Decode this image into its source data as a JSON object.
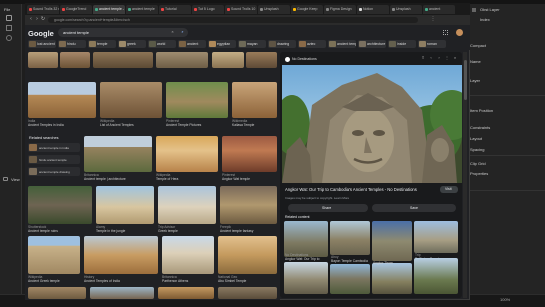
{
  "left_panel": {
    "file_label": "File",
    "view_label": "View",
    "doc_tab": "image"
  },
  "right_panel": {
    "tab1": "Obst Layer",
    "tab2": "Index",
    "labels": [
      "Compact",
      "Name",
      "Layer",
      "Item Position",
      "Constraints",
      "Layout",
      "Spacing",
      "Clip Grid",
      "Properties"
    ]
  },
  "browser": {
    "tabs": [
      {
        "label": "Sound Trolls 32 min",
        "color": "#e44"
      },
      {
        "label": "GoogleTrend",
        "color": "#e44"
      },
      {
        "label": "ancient temple - Google Images",
        "color": "#4a8"
      },
      {
        "label": "ancient temple",
        "color": "#4a8"
      },
      {
        "label": "Tutorial",
        "color": "#e44"
      },
      {
        "label": "Tut 5 Logo",
        "color": "#e44"
      },
      {
        "label": "Sound Trolls 10",
        "color": "#e44"
      },
      {
        "label": "Unsplash",
        "color": "#888"
      },
      {
        "label": "Google Keep",
        "color": "#fb0"
      },
      {
        "label": "Figma Design",
        "color": "#888"
      },
      {
        "label": "Notion",
        "color": "#ddd"
      },
      {
        "label": "Unsplash",
        "color": "#888"
      },
      {
        "label": "ancient",
        "color": "#4a8"
      }
    ],
    "address": "google.com/search?q=ancient+temple&tbm=isch"
  },
  "google": {
    "logo": "Google",
    "query": "ancient temple",
    "chips": [
      "lost ancient",
      "hindu",
      "temple",
      "greek",
      "world",
      "ancient",
      "egyptian",
      "mayan",
      "drawing",
      "aztec",
      "ancient temple",
      "architecture",
      "inside",
      "roman"
    ]
  },
  "results": {
    "related_title": "Related searches",
    "related": [
      "ancient temple in india",
      "hindu ancient temple",
      "ancient temple drawing"
    ],
    "captions": [
      {
        "src": "India",
        "title": "Ancient Temples in India"
      },
      {
        "src": "Wikipedia",
        "title": "List of Ancient Temples"
      },
      {
        "src": "Pinterest",
        "title": "Ancient Temple Pictures"
      },
      {
        "src": "Wikimedia",
        "title": "Kailasa Temple"
      },
      {
        "src": "Britannica",
        "title": "Ancient temple | architecture"
      },
      {
        "src": "Wikipedia",
        "title": "Temple of Hera"
      },
      {
        "src": "Pinterest",
        "title": "Angkor Wat temple"
      },
      {
        "src": "Shutterstock",
        "title": "Ancient temple ruins"
      },
      {
        "src": "Alamy",
        "title": "Temple in the jungle"
      },
      {
        "src": "Trip Advisor",
        "title": "Greek temple"
      },
      {
        "src": "Wikipedia",
        "title": "Ancient Greek temple"
      },
      {
        "src": "Freepik",
        "title": "Ancient temple fantasy"
      },
      {
        "src": "Britannica",
        "title": "Parthenon Athens"
      },
      {
        "src": "History",
        "title": "Ancient Temples of India"
      },
      {
        "src": "National Geo",
        "title": "Abu Simbel Temple"
      }
    ]
  },
  "preview": {
    "site": "No Destinations",
    "title": "Angkor Wat: Our Trip to Cambodia's Ancient Temples - No Destinations",
    "subtitle": "Images may be subject to copyright. Learn More",
    "visit_label": "Visit",
    "share_label": "Share",
    "save_label": "Save",
    "related_label": "Related content",
    "related": [
      {
        "title": "Angkor Wat: Our Trip to",
        "src": "No Destinations"
      },
      {
        "title": "Bayon Temple Cambodia",
        "src": "Ahoy"
      },
      {
        "title": "Angkor Thom",
        "src": "Lonely Planet"
      },
      {
        "title": "Ta Prohm Temple",
        "src": "Trip"
      }
    ]
  },
  "statusbar": {
    "zoom": "100%"
  },
  "colors": {
    "bg": "#1b1b1b",
    "browser_bg": "#202124",
    "accent": "#8ab4f8"
  }
}
